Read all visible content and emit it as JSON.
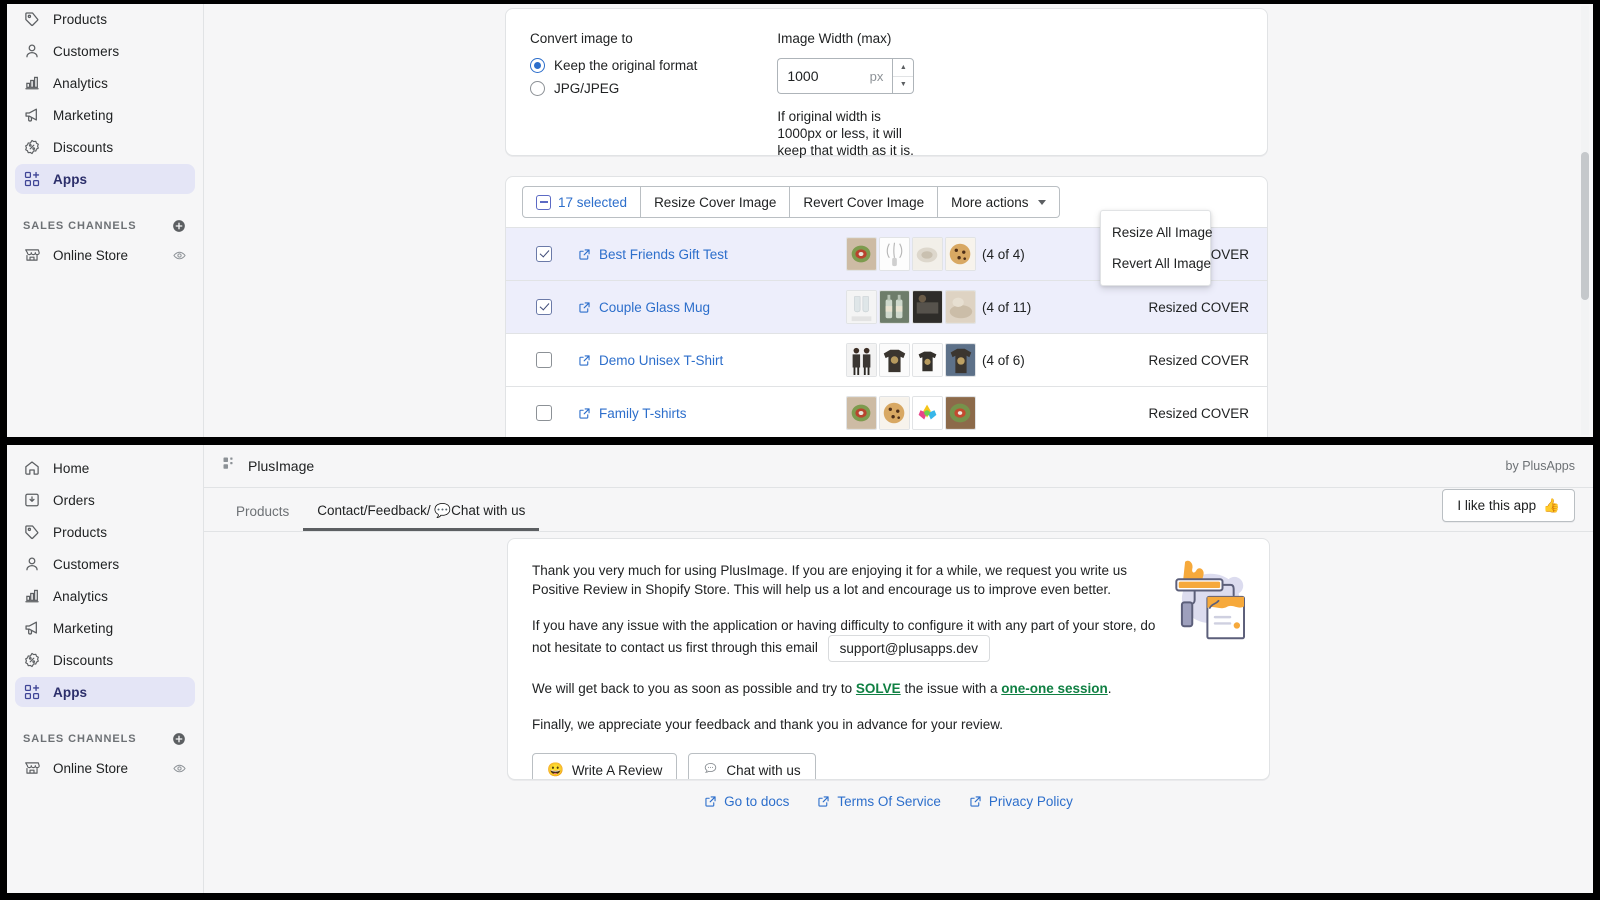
{
  "sidebar_top": {
    "items": [
      {
        "label": "Products",
        "icon": "tag-icon",
        "active": false
      },
      {
        "label": "Customers",
        "icon": "person-icon",
        "active": false
      },
      {
        "label": "Analytics",
        "icon": "bar-chart-icon",
        "active": false
      },
      {
        "label": "Marketing",
        "icon": "megaphone-icon",
        "active": false
      },
      {
        "label": "Discounts",
        "icon": "discount-icon",
        "active": false
      },
      {
        "label": "Apps",
        "icon": "apps-icon",
        "active": true
      }
    ],
    "section_title": "SALES CHANNELS",
    "add_channel_icon": "plus-circle-icon",
    "channels": [
      {
        "label": "Online Store",
        "icon": "store-icon",
        "view_icon": "eye-icon"
      }
    ]
  },
  "sidebar_bottom": {
    "items": [
      {
        "label": "Home",
        "icon": "home-icon",
        "active": false
      },
      {
        "label": "Orders",
        "icon": "orders-icon",
        "active": false
      },
      {
        "label": "Products",
        "icon": "tag-icon",
        "active": false
      },
      {
        "label": "Customers",
        "icon": "person-icon",
        "active": false
      },
      {
        "label": "Analytics",
        "icon": "bar-chart-icon",
        "active": false
      },
      {
        "label": "Marketing",
        "icon": "megaphone-icon",
        "active": false
      },
      {
        "label": "Discounts",
        "icon": "discount-icon",
        "active": false
      },
      {
        "label": "Apps",
        "icon": "apps-icon",
        "active": true
      }
    ],
    "section_title": "SALES CHANNELS",
    "add_channel_icon": "plus-circle-icon",
    "channels": [
      {
        "label": "Online Store",
        "icon": "store-icon",
        "view_icon": "eye-icon"
      }
    ]
  },
  "settings": {
    "convert_label": "Convert image to",
    "option_keep": "Keep the original format",
    "option_jpg": "JPG/JPEG",
    "selected_option": "Keep the original format",
    "width_label": "Image Width (max)",
    "width_value": "1000",
    "width_unit": "px",
    "helper_text": "If original width is 1000px or less, it will keep that width as it is."
  },
  "bulk_bar": {
    "selected_count": "17 selected",
    "resize_cover": "Resize Cover Image",
    "revert_cover": "Revert Cover Image",
    "more_actions": "More actions",
    "dropdown_items": [
      "Resize All Image",
      "Revert All Image"
    ]
  },
  "product_rows": [
    {
      "name": "Best Friends Gift Test",
      "selected": true,
      "count": "(4 of 4)",
      "status": "Resized COVER",
      "thumbs": [
        "bowl",
        "whisk",
        "plate",
        "cookie"
      ]
    },
    {
      "name": "Couple Glass Mug",
      "selected": true,
      "count": "(4 of 11)",
      "status": "Resized COVER",
      "thumbs": [
        "glass",
        "bottles",
        "dark",
        "sand"
      ]
    },
    {
      "name": "Demo Unisex T-Shirt",
      "selected": false,
      "count": "(4 of 6)",
      "status": "Resized COVER",
      "thumbs": [
        "couple",
        "tshirt",
        "tshirt2",
        "tshirt3"
      ]
    },
    {
      "name": "Family T-shirts",
      "selected": false,
      "count": "",
      "status": "Resized COVER",
      "thumbs": [
        "bowl",
        "cookie",
        "candy",
        "bowl2"
      ]
    }
  ],
  "app_bar": {
    "title": "PlusImage",
    "icon": "apps-icon",
    "by_line": "by PlusApps"
  },
  "tabs": [
    {
      "label": "Products",
      "active": false
    },
    {
      "label": "Contact/Feedback/ 💬Chat with us",
      "active": true
    }
  ],
  "like_button": {
    "label": "I like this app",
    "emoji": "👍"
  },
  "contact": {
    "para1": "Thank you very much for using PlusImage. If you are enjoying it for a while, we request you write us Positive Review in Shopify Store. This will help us a lot and encourage us to improve even better.",
    "para2_a": "If you have any issue with the application or having difficulty to configure it with any part of your store, do not hesitate to contact us first through this email",
    "email": "support@plusapps.dev",
    "para3_a": "We will get back to you as soon as possible and try to ",
    "solve": "SOLVE",
    "para3_b": " the issue with a ",
    "one_one": "one-one session",
    "para3_c": ".",
    "para4": "Finally, we appreciate your feedback and thank you in advance for your review.",
    "review_button": "Write A Review",
    "review_emoji": "😀",
    "chat_button": "Chat with us",
    "chat_icon": "chat-bubble-icon",
    "illustration": "paint-roller-bucket-illustration"
  },
  "footer": {
    "links": [
      {
        "label": "Go to docs",
        "icon": "external-link-icon"
      },
      {
        "label": "Terms Of Service",
        "icon": "external-link-icon"
      },
      {
        "label": "Privacy Policy",
        "icon": "external-link-icon"
      }
    ]
  },
  "colors": {
    "accent_blue": "#2c6ecb",
    "selected_row": "#edeefb",
    "active_nav": "#e4e5f6",
    "green_link": "#108043",
    "page_bg": "#f6f6f7"
  }
}
